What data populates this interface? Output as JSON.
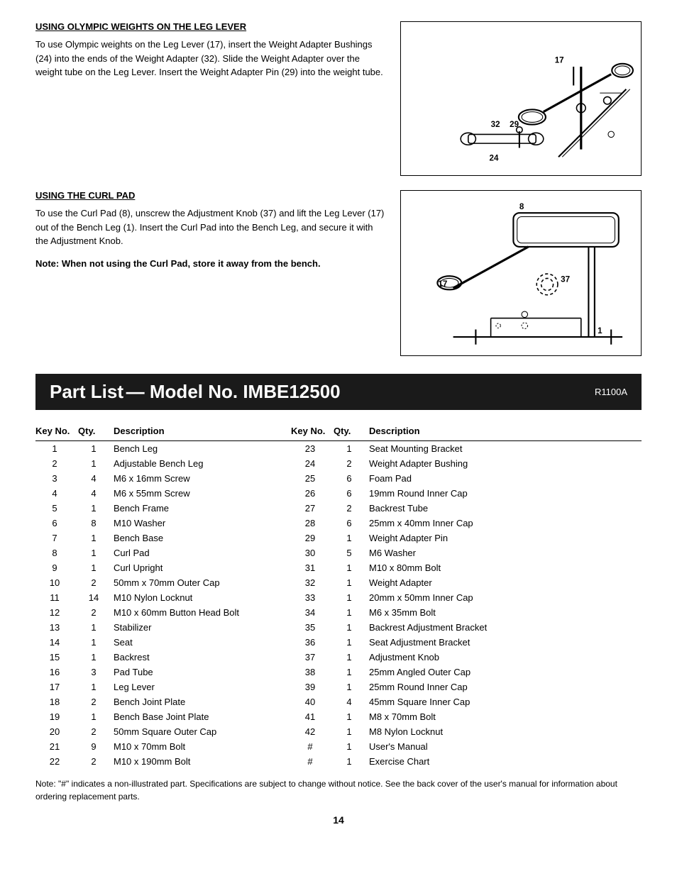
{
  "sections": {
    "section1": {
      "title": "USING OLYMPIC WEIGHTS ON THE LEG LEVER",
      "text": "To use Olympic weights on the Leg Lever (17), insert the Weight Adapter Bushings (24) into the ends of the Weight Adapter (32). Slide the Weight Adapter over the weight tube on the Leg Lever. Insert the Weight Adapter Pin (29) into the weight tube."
    },
    "section2": {
      "title": "USING THE CURL PAD",
      "text": "To use the Curl Pad (8), unscrew the Adjustment Knob (37) and lift the Leg Lever (17) out of the Bench Leg (1). Insert the Curl Pad into the Bench Leg, and secure it with the Adjustment Knob.",
      "note": "Note: When not using the Curl Pad, store it away from the bench."
    }
  },
  "partList": {
    "title": "Part List",
    "dash": "—",
    "modelLabel": "Model No. IMBE12500",
    "rev": "R1100A",
    "columns": {
      "keyNo": "Key No.",
      "qty": "Qty.",
      "description": "Description"
    },
    "leftParts": [
      {
        "key": "1",
        "qty": "1",
        "desc": "Bench Leg"
      },
      {
        "key": "2",
        "qty": "1",
        "desc": "Adjustable Bench Leg"
      },
      {
        "key": "3",
        "qty": "4",
        "desc": "M6 x 16mm Screw"
      },
      {
        "key": "4",
        "qty": "4",
        "desc": "M6 x 55mm Screw"
      },
      {
        "key": "5",
        "qty": "1",
        "desc": "Bench Frame"
      },
      {
        "key": "6",
        "qty": "8",
        "desc": "M10 Washer"
      },
      {
        "key": "7",
        "qty": "1",
        "desc": "Bench Base"
      },
      {
        "key": "8",
        "qty": "1",
        "desc": "Curl Pad"
      },
      {
        "key": "9",
        "qty": "1",
        "desc": "Curl Upright"
      },
      {
        "key": "10",
        "qty": "2",
        "desc": "50mm x 70mm Outer Cap"
      },
      {
        "key": "11",
        "qty": "14",
        "desc": "M10 Nylon Locknut"
      },
      {
        "key": "12",
        "qty": "2",
        "desc": "M10 x 60mm Button Head Bolt"
      },
      {
        "key": "13",
        "qty": "1",
        "desc": "Stabilizer"
      },
      {
        "key": "14",
        "qty": "1",
        "desc": "Seat"
      },
      {
        "key": "15",
        "qty": "1",
        "desc": "Backrest"
      },
      {
        "key": "16",
        "qty": "3",
        "desc": "Pad Tube"
      },
      {
        "key": "17",
        "qty": "1",
        "desc": "Leg Lever"
      },
      {
        "key": "18",
        "qty": "2",
        "desc": "Bench Joint Plate"
      },
      {
        "key": "19",
        "qty": "1",
        "desc": "Bench Base Joint Plate"
      },
      {
        "key": "20",
        "qty": "2",
        "desc": "50mm Square Outer Cap"
      },
      {
        "key": "21",
        "qty": "9",
        "desc": "M10 x 70mm Bolt"
      },
      {
        "key": "22",
        "qty": "2",
        "desc": "M10 x 190mm Bolt"
      }
    ],
    "rightParts": [
      {
        "key": "23",
        "qty": "1",
        "desc": "Seat Mounting Bracket"
      },
      {
        "key": "24",
        "qty": "2",
        "desc": "Weight Adapter Bushing"
      },
      {
        "key": "25",
        "qty": "6",
        "desc": "Foam Pad"
      },
      {
        "key": "26",
        "qty": "6",
        "desc": "19mm Round Inner Cap"
      },
      {
        "key": "27",
        "qty": "2",
        "desc": "Backrest Tube"
      },
      {
        "key": "28",
        "qty": "6",
        "desc": "25mm x 40mm Inner Cap"
      },
      {
        "key": "29",
        "qty": "1",
        "desc": "Weight Adapter Pin"
      },
      {
        "key": "30",
        "qty": "5",
        "desc": "M6 Washer"
      },
      {
        "key": "31",
        "qty": "1",
        "desc": "M10 x 80mm Bolt"
      },
      {
        "key": "32",
        "qty": "1",
        "desc": "Weight Adapter"
      },
      {
        "key": "33",
        "qty": "1",
        "desc": "20mm x 50mm Inner Cap"
      },
      {
        "key": "34",
        "qty": "1",
        "desc": "M6 x 35mm Bolt"
      },
      {
        "key": "35",
        "qty": "1",
        "desc": "Backrest Adjustment Bracket"
      },
      {
        "key": "36",
        "qty": "1",
        "desc": "Seat Adjustment Bracket"
      },
      {
        "key": "37",
        "qty": "1",
        "desc": "Adjustment Knob"
      },
      {
        "key": "38",
        "qty": "1",
        "desc": "25mm Angled Outer Cap"
      },
      {
        "key": "39",
        "qty": "1",
        "desc": "25mm Round Inner Cap"
      },
      {
        "key": "40",
        "qty": "4",
        "desc": "45mm Square Inner Cap"
      },
      {
        "key": "41",
        "qty": "1",
        "desc": "M8 x 70mm Bolt"
      },
      {
        "key": "42",
        "qty": "1",
        "desc": "M8 Nylon Locknut"
      },
      {
        "key": "#",
        "qty": "1",
        "desc": "User's Manual"
      },
      {
        "key": "#",
        "qty": "1",
        "desc": "Exercise Chart"
      }
    ],
    "footerNote": "Note: \"#\" indicates a non-illustrated part. Specifications are subject to change without notice. See the back cover of the user's manual for information about ordering replacement parts.",
    "pageNumber": "14"
  }
}
